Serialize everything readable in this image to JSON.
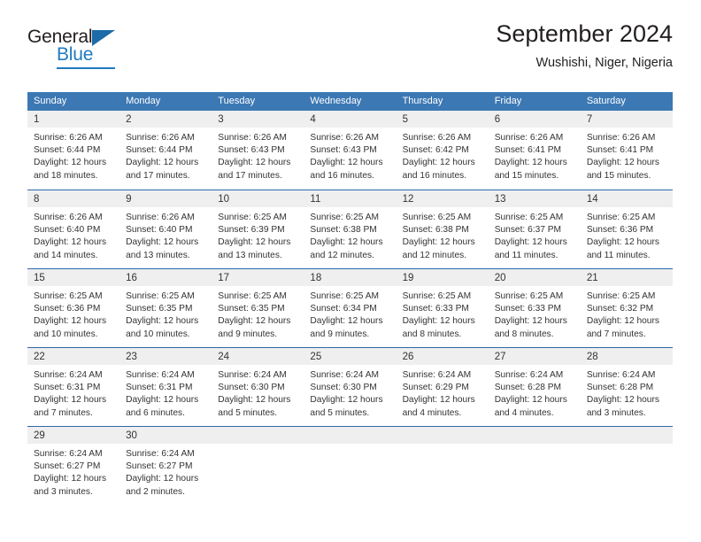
{
  "brand": {
    "name_part1": "General",
    "name_part2": "Blue"
  },
  "header": {
    "title": "September 2024",
    "subtitle": "Wushishi, Niger, Nigeria"
  },
  "colors": {
    "header_blue": "#3c78b4",
    "row_rule": "#2f6aa8",
    "day_band": "#efefef",
    "brand_blue": "#1f7ac0",
    "text": "#333333"
  },
  "weekdays": [
    "Sunday",
    "Monday",
    "Tuesday",
    "Wednesday",
    "Thursday",
    "Friday",
    "Saturday"
  ],
  "weeks": [
    [
      {
        "day": "1",
        "lines": [
          "Sunrise: 6:26 AM",
          "Sunset: 6:44 PM",
          "Daylight: 12 hours",
          "and 18 minutes."
        ]
      },
      {
        "day": "2",
        "lines": [
          "Sunrise: 6:26 AM",
          "Sunset: 6:44 PM",
          "Daylight: 12 hours",
          "and 17 minutes."
        ]
      },
      {
        "day": "3",
        "lines": [
          "Sunrise: 6:26 AM",
          "Sunset: 6:43 PM",
          "Daylight: 12 hours",
          "and 17 minutes."
        ]
      },
      {
        "day": "4",
        "lines": [
          "Sunrise: 6:26 AM",
          "Sunset: 6:43 PM",
          "Daylight: 12 hours",
          "and 16 minutes."
        ]
      },
      {
        "day": "5",
        "lines": [
          "Sunrise: 6:26 AM",
          "Sunset: 6:42 PM",
          "Daylight: 12 hours",
          "and 16 minutes."
        ]
      },
      {
        "day": "6",
        "lines": [
          "Sunrise: 6:26 AM",
          "Sunset: 6:41 PM",
          "Daylight: 12 hours",
          "and 15 minutes."
        ]
      },
      {
        "day": "7",
        "lines": [
          "Sunrise: 6:26 AM",
          "Sunset: 6:41 PM",
          "Daylight: 12 hours",
          "and 15 minutes."
        ]
      }
    ],
    [
      {
        "day": "8",
        "lines": [
          "Sunrise: 6:26 AM",
          "Sunset: 6:40 PM",
          "Daylight: 12 hours",
          "and 14 minutes."
        ]
      },
      {
        "day": "9",
        "lines": [
          "Sunrise: 6:26 AM",
          "Sunset: 6:40 PM",
          "Daylight: 12 hours",
          "and 13 minutes."
        ]
      },
      {
        "day": "10",
        "lines": [
          "Sunrise: 6:25 AM",
          "Sunset: 6:39 PM",
          "Daylight: 12 hours",
          "and 13 minutes."
        ]
      },
      {
        "day": "11",
        "lines": [
          "Sunrise: 6:25 AM",
          "Sunset: 6:38 PM",
          "Daylight: 12 hours",
          "and 12 minutes."
        ]
      },
      {
        "day": "12",
        "lines": [
          "Sunrise: 6:25 AM",
          "Sunset: 6:38 PM",
          "Daylight: 12 hours",
          "and 12 minutes."
        ]
      },
      {
        "day": "13",
        "lines": [
          "Sunrise: 6:25 AM",
          "Sunset: 6:37 PM",
          "Daylight: 12 hours",
          "and 11 minutes."
        ]
      },
      {
        "day": "14",
        "lines": [
          "Sunrise: 6:25 AM",
          "Sunset: 6:36 PM",
          "Daylight: 12 hours",
          "and 11 minutes."
        ]
      }
    ],
    [
      {
        "day": "15",
        "lines": [
          "Sunrise: 6:25 AM",
          "Sunset: 6:36 PM",
          "Daylight: 12 hours",
          "and 10 minutes."
        ]
      },
      {
        "day": "16",
        "lines": [
          "Sunrise: 6:25 AM",
          "Sunset: 6:35 PM",
          "Daylight: 12 hours",
          "and 10 minutes."
        ]
      },
      {
        "day": "17",
        "lines": [
          "Sunrise: 6:25 AM",
          "Sunset: 6:35 PM",
          "Daylight: 12 hours",
          "and 9 minutes."
        ]
      },
      {
        "day": "18",
        "lines": [
          "Sunrise: 6:25 AM",
          "Sunset: 6:34 PM",
          "Daylight: 12 hours",
          "and 9 minutes."
        ]
      },
      {
        "day": "19",
        "lines": [
          "Sunrise: 6:25 AM",
          "Sunset: 6:33 PM",
          "Daylight: 12 hours",
          "and 8 minutes."
        ]
      },
      {
        "day": "20",
        "lines": [
          "Sunrise: 6:25 AM",
          "Sunset: 6:33 PM",
          "Daylight: 12 hours",
          "and 8 minutes."
        ]
      },
      {
        "day": "21",
        "lines": [
          "Sunrise: 6:25 AM",
          "Sunset: 6:32 PM",
          "Daylight: 12 hours",
          "and 7 minutes."
        ]
      }
    ],
    [
      {
        "day": "22",
        "lines": [
          "Sunrise: 6:24 AM",
          "Sunset: 6:31 PM",
          "Daylight: 12 hours",
          "and 7 minutes."
        ]
      },
      {
        "day": "23",
        "lines": [
          "Sunrise: 6:24 AM",
          "Sunset: 6:31 PM",
          "Daylight: 12 hours",
          "and 6 minutes."
        ]
      },
      {
        "day": "24",
        "lines": [
          "Sunrise: 6:24 AM",
          "Sunset: 6:30 PM",
          "Daylight: 12 hours",
          "and 5 minutes."
        ]
      },
      {
        "day": "25",
        "lines": [
          "Sunrise: 6:24 AM",
          "Sunset: 6:30 PM",
          "Daylight: 12 hours",
          "and 5 minutes."
        ]
      },
      {
        "day": "26",
        "lines": [
          "Sunrise: 6:24 AM",
          "Sunset: 6:29 PM",
          "Daylight: 12 hours",
          "and 4 minutes."
        ]
      },
      {
        "day": "27",
        "lines": [
          "Sunrise: 6:24 AM",
          "Sunset: 6:28 PM",
          "Daylight: 12 hours",
          "and 4 minutes."
        ]
      },
      {
        "day": "28",
        "lines": [
          "Sunrise: 6:24 AM",
          "Sunset: 6:28 PM",
          "Daylight: 12 hours",
          "and 3 minutes."
        ]
      }
    ],
    [
      {
        "day": "29",
        "lines": [
          "Sunrise: 6:24 AM",
          "Sunset: 6:27 PM",
          "Daylight: 12 hours",
          "and 3 minutes."
        ]
      },
      {
        "day": "30",
        "lines": [
          "Sunrise: 6:24 AM",
          "Sunset: 6:27 PM",
          "Daylight: 12 hours",
          "and 2 minutes."
        ]
      },
      {
        "day": "",
        "lines": []
      },
      {
        "day": "",
        "lines": []
      },
      {
        "day": "",
        "lines": []
      },
      {
        "day": "",
        "lines": []
      },
      {
        "day": "",
        "lines": []
      }
    ]
  ]
}
